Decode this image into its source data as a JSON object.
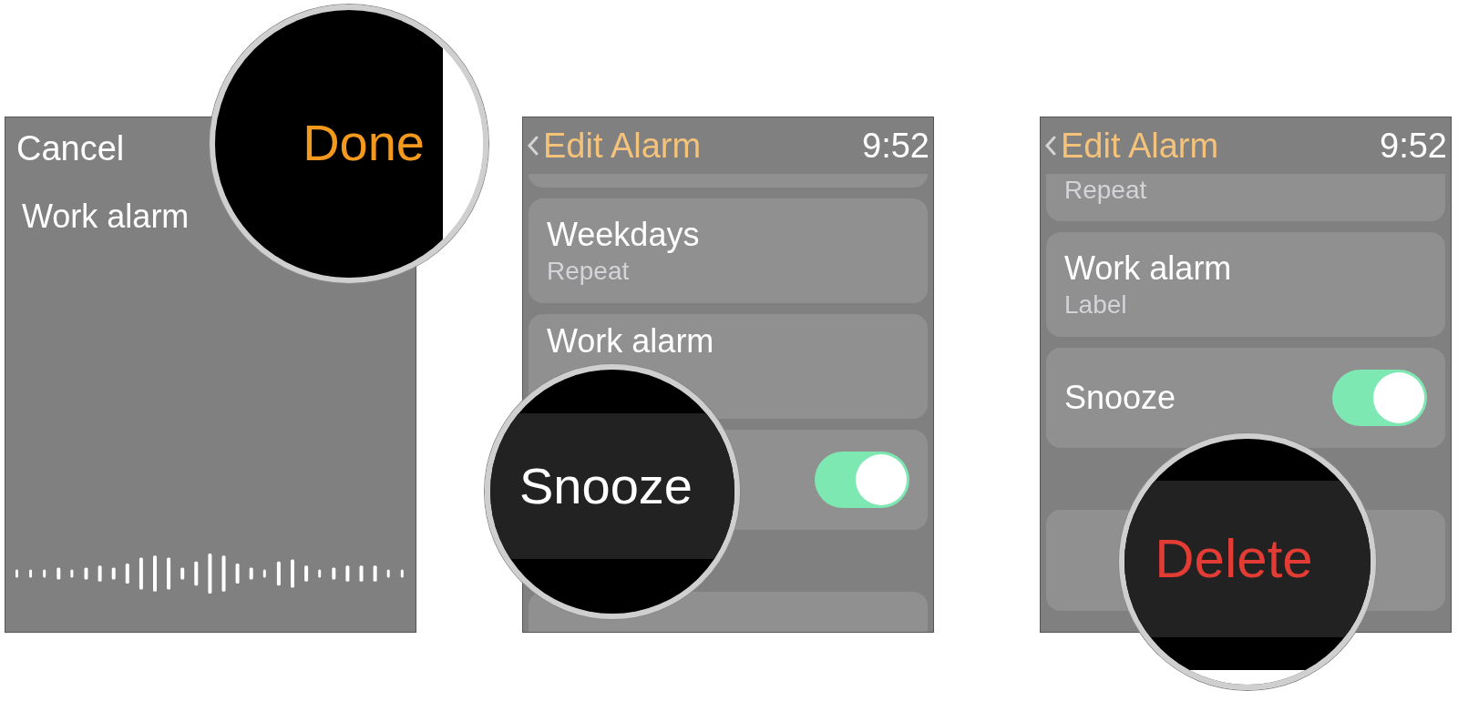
{
  "panels": [
    {
      "kind": "dictation",
      "cancel_button": "Cancel",
      "transcript": "Work alarm",
      "magnifier": {
        "kind": "action",
        "text": "Done"
      }
    },
    {
      "kind": "edit_alarm",
      "title": "Edit Alarm",
      "time": "9:52",
      "rows": [
        {
          "kind": "stub"
        },
        {
          "kind": "detail",
          "title": "Weekdays",
          "subtitle": "Repeat"
        },
        {
          "kind": "detail",
          "title": "Work alarm"
        },
        {
          "kind": "toggle",
          "on": true
        },
        {
          "kind": "spacer"
        },
        {
          "kind": "button"
        }
      ],
      "magnifier": {
        "kind": "label",
        "text": "Snooze"
      }
    },
    {
      "kind": "edit_alarm",
      "title": "Edit Alarm",
      "time": "9:52",
      "rows": [
        {
          "kind": "detail",
          "subtitle": "Repeat"
        },
        {
          "kind": "detail",
          "title": "Work alarm",
          "subtitle": "Label"
        },
        {
          "kind": "toggle",
          "title": "Snooze",
          "on": true
        },
        {
          "kind": "spacer"
        },
        {
          "kind": "button"
        }
      ],
      "magnifier": {
        "kind": "destructive",
        "text": "Delete"
      }
    }
  ]
}
